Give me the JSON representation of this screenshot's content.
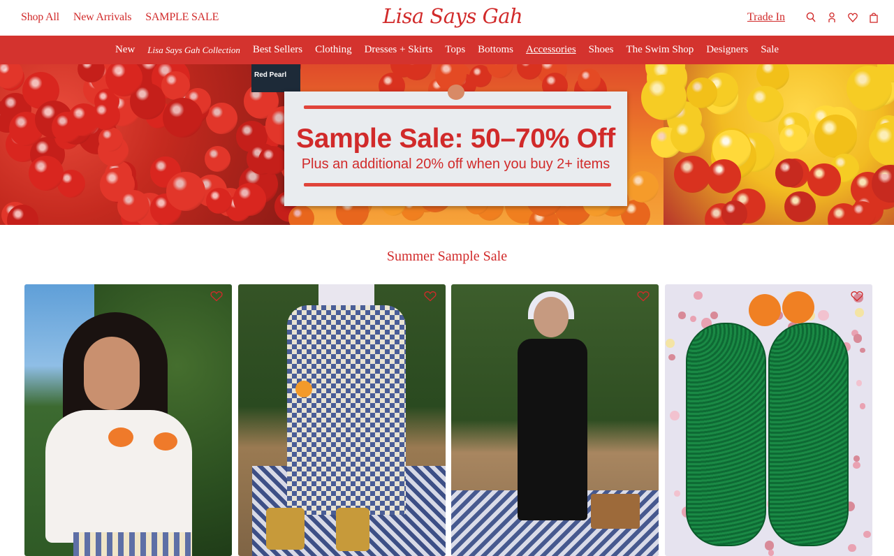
{
  "header": {
    "left_links": [
      "Shop All",
      "New Arrivals",
      "SAMPLE SALE"
    ],
    "logo": "Lisa Says Gah",
    "trade_in": "Trade In",
    "icons": [
      "search-icon",
      "account-icon",
      "wishlist-heart-icon",
      "shopping-bag-icon"
    ]
  },
  "nav": {
    "items": [
      "New",
      "Lisa Says Gah Collection",
      "Best Sellers",
      "Clothing",
      "Dresses + Skirts",
      "Tops",
      "Bottoms",
      "Accessories",
      "Shoes",
      "The Swim Shop",
      "Designers",
      "Sale"
    ],
    "active": "Accessories"
  },
  "hero": {
    "bag_label": "Red Pearl",
    "headline": "Sample Sale: 50–70% Off",
    "subheadline": "Plus an additional 20% off when you buy 2+ items"
  },
  "section": {
    "title": "Summer Sample Sale"
  },
  "products": [
    {
      "image": "woman in orange print tee"
    },
    {
      "image": "blue gingham maxi skirt"
    },
    {
      "image": "black tiered maxi dress"
    },
    {
      "image": "green woven mary jane flats"
    }
  ],
  "colors": {
    "brand_red": "#d12a2a",
    "nav_red": "#d4332e",
    "white": "#ffffff"
  }
}
